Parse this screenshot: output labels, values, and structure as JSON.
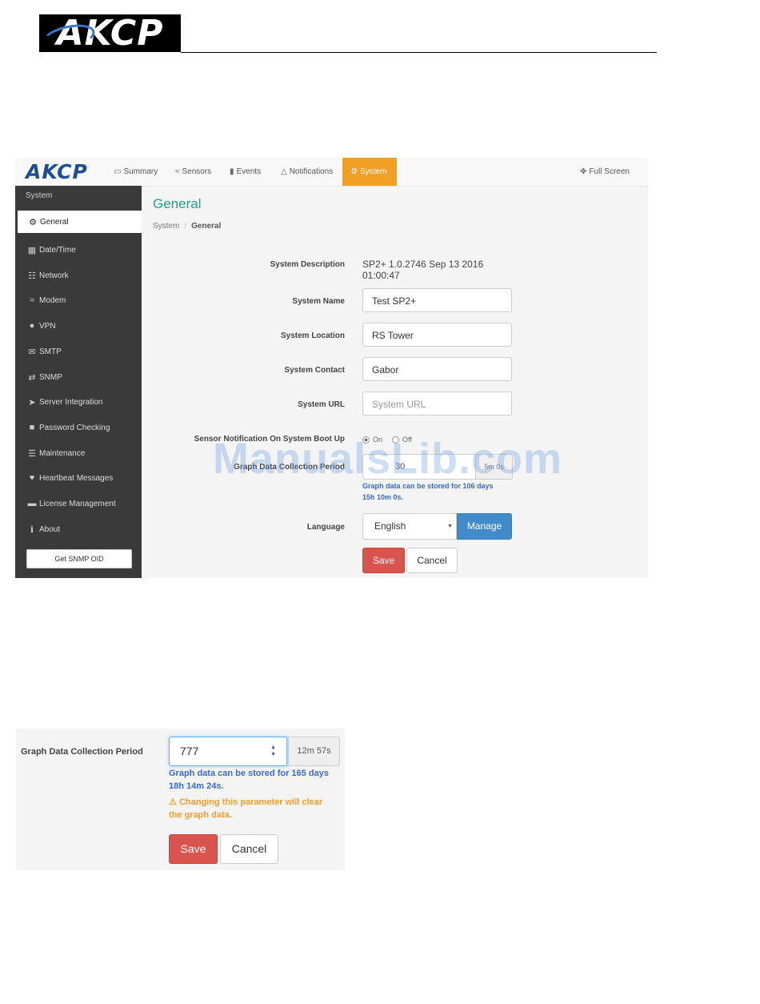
{
  "document": {
    "logo_text": "AKCP"
  },
  "app": {
    "brand": "AKCP",
    "nav": [
      {
        "icon": "monitor-icon",
        "label": "Summary"
      },
      {
        "icon": "rss-icon",
        "label": "Sensors"
      },
      {
        "icon": "book-icon",
        "label": "Events"
      },
      {
        "icon": "bell-icon",
        "label": "Notifications"
      },
      {
        "icon": "gears-icon",
        "label": "System"
      }
    ],
    "fullscreen_label": "Full Screen",
    "accent_color": "#f2a024"
  },
  "sidebar": {
    "title": "System",
    "items": [
      {
        "icon": "gears-icon",
        "label": "General"
      },
      {
        "icon": "calendar-icon",
        "label": "Date/Time"
      },
      {
        "icon": "sitemap-icon",
        "label": "Network"
      },
      {
        "icon": "wifi-icon",
        "label": "Modem"
      },
      {
        "icon": "globe-icon",
        "label": "VPN"
      },
      {
        "icon": "envelope-icon",
        "label": "SMTP"
      },
      {
        "icon": "exchange-icon",
        "label": "SNMP"
      },
      {
        "icon": "paper-plane-icon",
        "label": "Server Integration"
      },
      {
        "icon": "lock-icon",
        "label": "Password Checking"
      },
      {
        "icon": "database-icon",
        "label": "Maintenance"
      },
      {
        "icon": "heart-icon",
        "label": "Heartbeat Messages"
      },
      {
        "icon": "credit-card-icon",
        "label": "License Management"
      },
      {
        "icon": "info-icon",
        "label": "About"
      }
    ],
    "snmp_button": "Get SNMP OID"
  },
  "page": {
    "title": "General",
    "breadcrumb": [
      "System",
      "General"
    ],
    "fields": {
      "description_label": "System Description",
      "description_value_line1": "SP2+ 1.0.2746 Sep 13 2016",
      "description_value_line2": "01:00:47",
      "name_label": "System Name",
      "name_value": "Test SP2+",
      "location_label": "System Location",
      "location_value": "RS Tower",
      "contact_label": "System Contact",
      "contact_value": "Gabor",
      "url_label": "System URL",
      "url_placeholder": "System URL",
      "boot_label": "Sensor Notification On System Boot Up",
      "boot_on": "On",
      "boot_off": "Off",
      "graph_label": "Graph Data Collection Period",
      "graph_value": "30",
      "graph_addon": "5m 0s",
      "graph_help_line1": "Graph data can be stored for 106 days",
      "graph_help_line2": "15h 10m 0s.",
      "language_label": "Language",
      "language_value": "English",
      "manage_button": "Manage",
      "save_button": "Save",
      "cancel_button": "Cancel"
    }
  },
  "watermark": "ManualsLib.com",
  "detail": {
    "label": "Graph Data Collection Period",
    "value": "777",
    "addon": "12m 57s",
    "help_line1": "Graph data can be stored for 165 days",
    "help_line2": "18h 14m 24s.",
    "warning_line1": "Changing this parameter will clear",
    "warning_line2": "the graph data.",
    "save_button": "Save",
    "cancel_button": "Cancel"
  }
}
